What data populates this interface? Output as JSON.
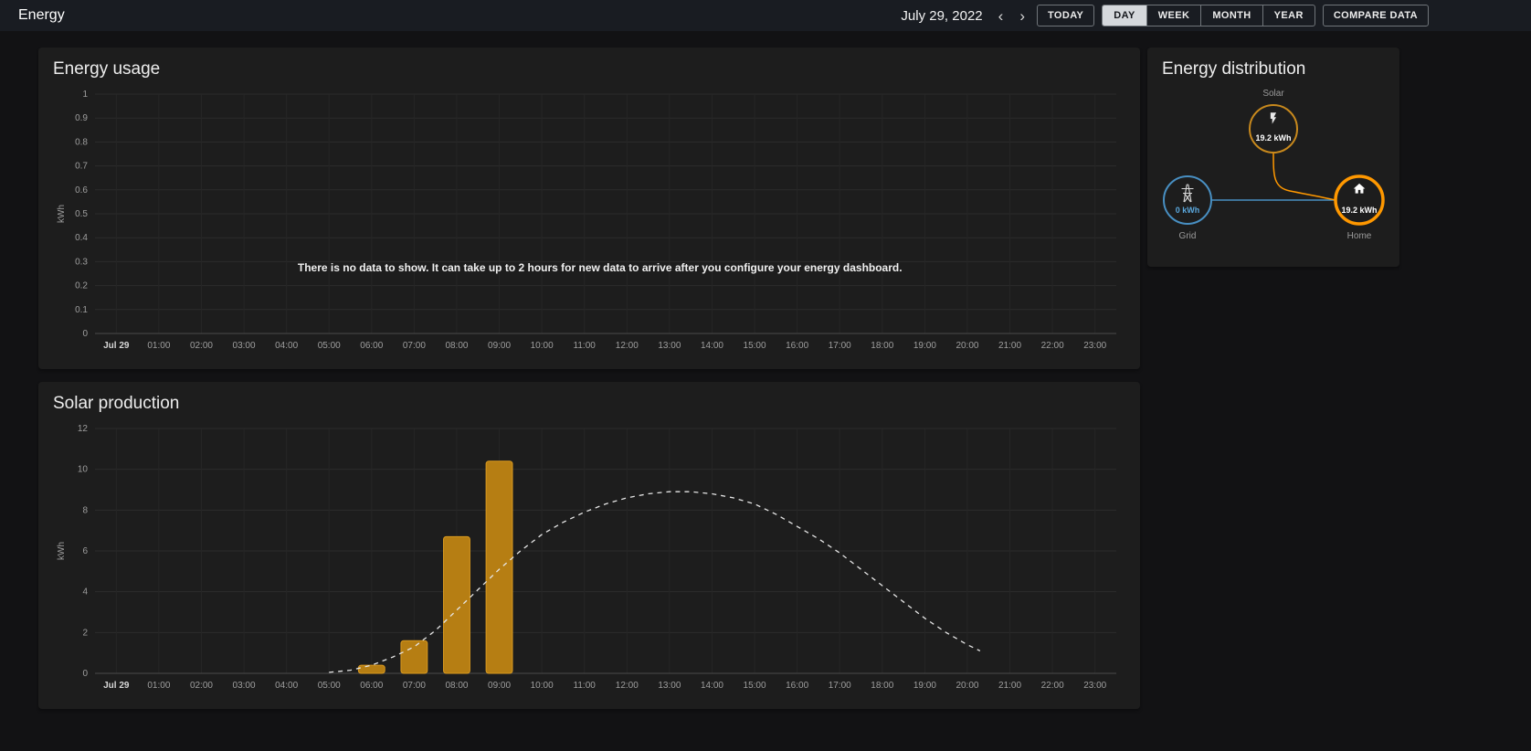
{
  "header": {
    "title": "Energy",
    "date": "July 29, 2022",
    "prev_icon": "‹",
    "next_icon": "›",
    "today_label": "TODAY",
    "period_buttons": [
      "DAY",
      "WEEK",
      "MONTH",
      "YEAR"
    ],
    "selected_period": "DAY",
    "compare_label": "COMPARE DATA"
  },
  "usage_card": {
    "title": "Energy usage",
    "no_data_message": "There is no data to show. It can take up to 2 hours for new data to arrive after you configure your energy dashboard."
  },
  "solar_card": {
    "title": "Solar production"
  },
  "distribution_card": {
    "title": "Energy distribution",
    "solar": {
      "label": "Solar",
      "value": "19.2 kWh",
      "color": "#c8891d"
    },
    "grid": {
      "label": "Grid",
      "value": "0 kWh",
      "color": "#488fc2",
      "value_color": "#5aa7dc"
    },
    "home": {
      "label": "Home",
      "value": "19.2 kWh",
      "color": "#ff9800"
    }
  },
  "chart_data": [
    {
      "type": "bar",
      "title": "Energy usage",
      "ylabel": "kWh",
      "ylim": [
        0,
        1
      ],
      "yticks": [
        0,
        0.1,
        0.2,
        0.3,
        0.4,
        0.5,
        0.6,
        0.7,
        0.8,
        0.9,
        1
      ],
      "categories": [
        "Jul 29",
        "01:00",
        "02:00",
        "03:00",
        "04:00",
        "05:00",
        "06:00",
        "07:00",
        "08:00",
        "09:00",
        "10:00",
        "11:00",
        "12:00",
        "13:00",
        "14:00",
        "15:00",
        "16:00",
        "17:00",
        "18:00",
        "19:00",
        "20:00",
        "21:00",
        "22:00",
        "23:00"
      ],
      "values": [],
      "grid_on": true,
      "note": "empty chart - no data"
    },
    {
      "type": "bar",
      "title": "Solar production",
      "ylabel": "kWh",
      "ylim": [
        0,
        12
      ],
      "yticks": [
        0,
        2,
        4,
        6,
        8,
        10,
        12
      ],
      "categories": [
        "Jul 29",
        "01:00",
        "02:00",
        "03:00",
        "04:00",
        "05:00",
        "06:00",
        "07:00",
        "08:00",
        "09:00",
        "10:00",
        "11:00",
        "12:00",
        "13:00",
        "14:00",
        "15:00",
        "16:00",
        "17:00",
        "18:00",
        "19:00",
        "20:00",
        "21:00",
        "22:00",
        "23:00"
      ],
      "series_name": "Solar production",
      "values": [
        0,
        0,
        0,
        0,
        0,
        0,
        0.4,
        1.6,
        6.7,
        10.4,
        0,
        0,
        0,
        0,
        0,
        0,
        0,
        0,
        0,
        0,
        0,
        0,
        0,
        0
      ],
      "bar_color": "#b67e13",
      "bar_border": "#d9991f",
      "forecast_name": "Solar forecast",
      "forecast": [
        [
          5,
          0.05
        ],
        [
          5.5,
          0.15
        ],
        [
          6,
          0.4
        ],
        [
          6.5,
          0.8
        ],
        [
          7,
          1.3
        ],
        [
          7.5,
          2.1
        ],
        [
          8,
          3.1
        ],
        [
          8.5,
          4.1
        ],
        [
          9,
          5.1
        ],
        [
          9.5,
          6.0
        ],
        [
          10,
          6.8
        ],
        [
          10.5,
          7.4
        ],
        [
          11,
          7.9
        ],
        [
          11.5,
          8.3
        ],
        [
          12,
          8.6
        ],
        [
          12.5,
          8.8
        ],
        [
          13,
          8.9
        ],
        [
          13.5,
          8.9
        ],
        [
          14,
          8.8
        ],
        [
          14.5,
          8.6
        ],
        [
          15,
          8.3
        ],
        [
          15.5,
          7.8
        ],
        [
          16,
          7.2
        ],
        [
          16.5,
          6.6
        ],
        [
          17,
          5.9
        ],
        [
          17.5,
          5.1
        ],
        [
          18,
          4.3
        ],
        [
          18.5,
          3.5
        ],
        [
          19,
          2.7
        ],
        [
          19.5,
          2.0
        ],
        [
          20,
          1.4
        ],
        [
          20.3,
          1.1
        ]
      ],
      "grid_on": true
    }
  ]
}
